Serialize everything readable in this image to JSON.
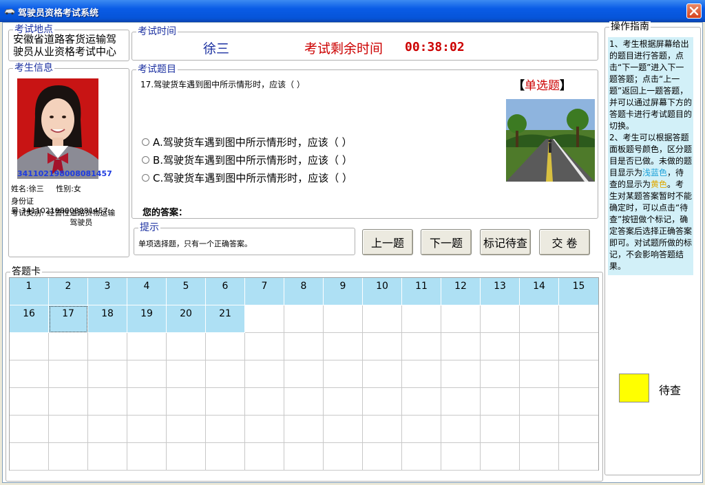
{
  "window": {
    "title": "驾驶员资格考试系统",
    "close_label": "×"
  },
  "exam_location": {
    "label": "考试地点",
    "text": "安徽省道路客货运输驾驶员从业资格考试中心"
  },
  "examinee": {
    "label": "考生信息",
    "photo_id": "341102198008081457",
    "name_label": "姓名:",
    "name": "徐三",
    "gender_label": "性别:",
    "gender": "女",
    "id_label": "身份证号:",
    "id_number": "341102198008081457",
    "category_label": "考试类别:",
    "category": "经营性道路货物运输驾驶员"
  },
  "exam_time": {
    "label": "考试时间",
    "examinee_name": "徐三",
    "remaining_label": "考试剩余时间",
    "remaining": "00:38:02"
  },
  "question": {
    "label": "考试题目",
    "text": "17.驾驶货车遇到图中所示情形时，应该（ ）",
    "type_open": "【",
    "type": "单选题",
    "type_close": "】",
    "options": [
      "A.驾驶货车遇到图中所示情形时，应该（ ）",
      "B.驾驶货车遇到图中所示情形时，应该（ ）",
      "C.驾驶货车遇到图中所示情形时，应该（ ）"
    ],
    "answer_label": "您的答案："
  },
  "hint": {
    "label": "提示",
    "text": "单项选择题，只有一个正确答案。"
  },
  "buttons": {
    "prev": "上一题",
    "next": "下一题",
    "mark": "标记待查",
    "submit": "交 卷"
  },
  "answer_card": {
    "label": "答题卡",
    "questions": [
      "1",
      "2",
      "3",
      "4",
      "5",
      "6",
      "7",
      "8",
      "9",
      "10",
      "11",
      "12",
      "13",
      "14",
      "15",
      "16",
      "17",
      "18",
      "19",
      "20",
      "21"
    ],
    "current": "17",
    "question_color": "#aee0f4"
  },
  "guide": {
    "label": "操作指南",
    "p1": "1、考生根据屏幕给出的题目进行答题，点击“下一题”进入下一题答题；点击“上一题”返回上一题答题，并可以通过屏幕下方的答题卡进行考试题目的切换。",
    "p2a": "2、考生可以根据答题面板题号颜色，区分题目是否已做。未做的题目显示为",
    "p2_blue": "浅蓝色",
    "p2b": "，待查的显示为",
    "p2_yellow": "黄色",
    "p2c": "。考生对某题答案暂时不能确定时，可以点击“待查”按钮做个标记，确定答案后选择正确答案即可。对试题所做的标记，不会影响答题结果。",
    "blue_color": "#1fa2d8",
    "yellow_color": "#e0a800"
  },
  "legend": {
    "pending_label": "待查",
    "pending_color": "#ffff00"
  }
}
